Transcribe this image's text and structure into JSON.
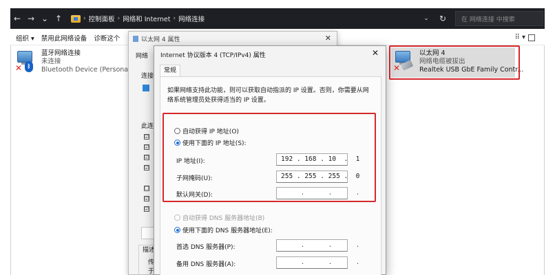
{
  "addressbar": {
    "back": "←",
    "forward": "→",
    "history": "⌄",
    "up": "↑",
    "crumbs": [
      "控制面板",
      "网络和 Internet",
      "网络连接"
    ],
    "dropdown": "⌄",
    "refresh": "↻",
    "search_placeholder": "在 网络连接 中搜索"
  },
  "toolbar": {
    "organize": "组织 ▾",
    "disable": "禁用此网络设备",
    "diagnose": "诊断这个",
    "view": "⠿ ▾"
  },
  "adapters": [
    {
      "name": "蓝牙网络连接",
      "status": "未连接",
      "device": "Bluetooth Device (Personal Ar"
    },
    {
      "name": "以太网 4",
      "status": "网络电缆被拔出",
      "device": "Realtek USB GbE Family Contr..."
    }
  ],
  "back_window": {
    "title": "以太网 4 属性",
    "close": "✕",
    "tab_network": "网络",
    "label_connect": "连接时",
    "label_items": "此连接",
    "label_desc": "描述",
    "desc_line1": "传",
    "desc_line2": "于",
    "checks": [
      "☑",
      "☑",
      "☑",
      "☑",
      "☐",
      "☑",
      "☑"
    ]
  },
  "dialog": {
    "title": "Internet 协议版本 4 (TCP/IPv4) 属性",
    "close": "✕",
    "tab_general": "常规",
    "description": "如果网络支持此功能，则可以获取自动指派的 IP 设置。否则，你需要从网络系统管理员处获得适当的 IP 设置。",
    "auto_ip": "自动获得 IP 地址(O)",
    "manual_ip": "使用下面的 IP 地址(S):",
    "ip_label": "IP 地址(I):",
    "ip_value": "192 . 168 . 10  .  1",
    "mask_label": "子网掩码(U):",
    "mask_value": "255 . 255 . 255 .  0",
    "gateway_label": "默认网关(D):",
    "gateway_value": "     .      .      .",
    "auto_dns": "自动获得 DNS 服务器地址(B)",
    "manual_dns": "使用下面的 DNS 服务器地址(E):",
    "dns1_label": "首选 DNS 服务器(P):",
    "dns1_value": "     .      .      .",
    "dns2_label": "备用 DNS 服务器(A):",
    "dns2_value": "     .      .      ."
  },
  "colors": {
    "highlight": "#d7262b",
    "accent": "#1f6fd1",
    "titlebar": "#1e1f24"
  }
}
